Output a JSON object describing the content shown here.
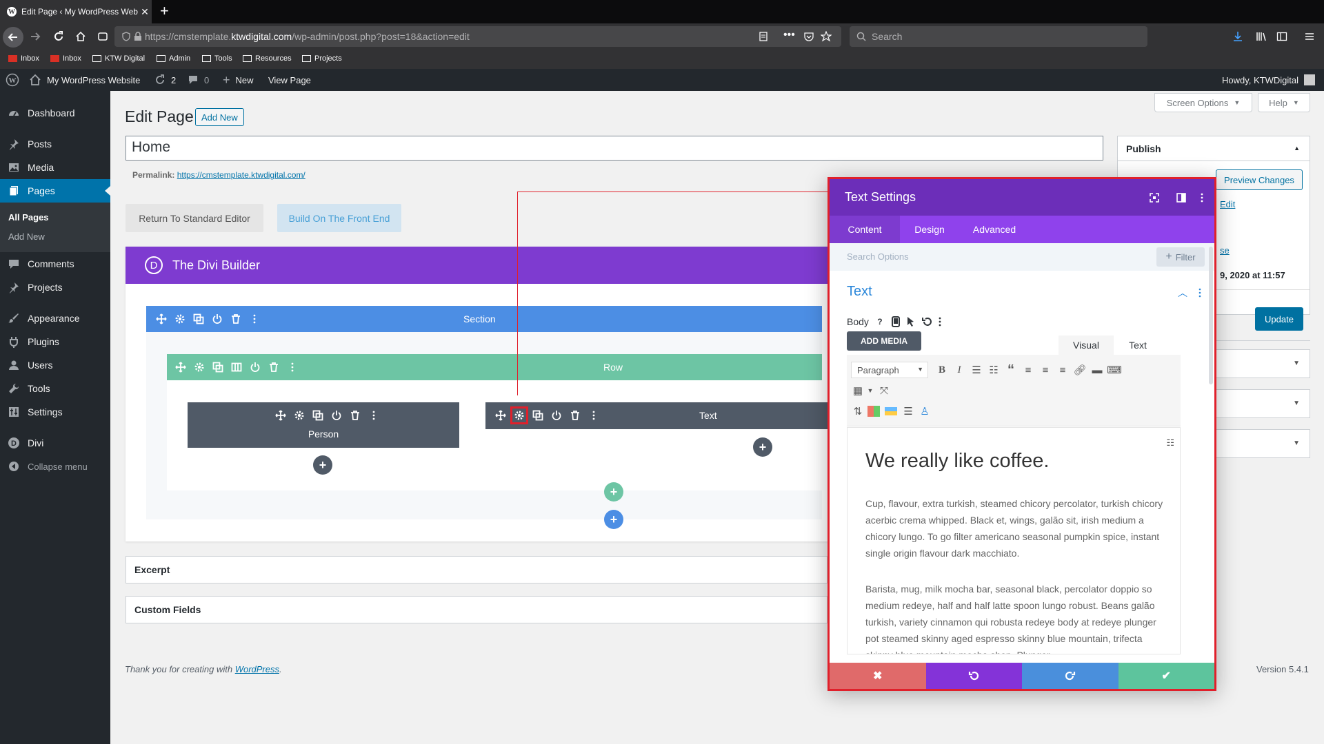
{
  "browser": {
    "tab_title": "Edit Page ‹ My WordPress Webs",
    "url_prefix": "https://cmstemplate.",
    "url_domain": "ktwdigital.com",
    "url_suffix": "/wp-admin/post.php?post=18&action=edit",
    "search_placeholder": "Search",
    "bookmarks": [
      "Inbox",
      "Inbox",
      "KTW Digital",
      "Admin",
      "Tools",
      "Resources",
      "Projects"
    ]
  },
  "adminbar": {
    "site_name": "My WordPress Website",
    "updates_count": "2",
    "comments_count": "0",
    "new_label": "New",
    "view_page": "View Page",
    "howdy": "Howdy, KTWDigital"
  },
  "sidebar": {
    "items": [
      {
        "label": "Dashboard",
        "icon": "dashboard-icon"
      },
      {
        "label": "Posts",
        "icon": "pin-icon"
      },
      {
        "label": "Media",
        "icon": "media-icon"
      },
      {
        "label": "Pages",
        "icon": "pages-icon"
      },
      {
        "label": "Comments",
        "icon": "comment-icon"
      },
      {
        "label": "Projects",
        "icon": "pin-icon"
      },
      {
        "label": "Appearance",
        "icon": "brush-icon"
      },
      {
        "label": "Plugins",
        "icon": "plugin-icon"
      },
      {
        "label": "Users",
        "icon": "user-icon"
      },
      {
        "label": "Tools",
        "icon": "wrench-icon"
      },
      {
        "label": "Settings",
        "icon": "settings-icon"
      },
      {
        "label": "Divi",
        "icon": "divi-icon"
      },
      {
        "label": "Collapse menu",
        "icon": "collapse-icon"
      }
    ],
    "sub_items": [
      "All Pages",
      "Add New"
    ]
  },
  "main": {
    "heading": "Edit Page",
    "add_new": "Add New",
    "title_value": "Home",
    "permalink_label": "Permalink:",
    "permalink_url": "https://cmstemplate.ktwdigital.com/",
    "return_btn": "Return To Standard Editor",
    "build_btn": "Build On The Front End"
  },
  "builder": {
    "title": "The Divi Builder",
    "logo_letter": "D",
    "section_label": "Section",
    "row_label": "Row",
    "module_person": "Person",
    "module_text": "Text"
  },
  "metaboxes": {
    "excerpt": "Excerpt",
    "custom_fields": "Custom Fields"
  },
  "footer": {
    "thanks": "Thank you for creating with ",
    "wp_link": "WordPress",
    "period": ".",
    "version": "Version 5.4.1"
  },
  "right": {
    "screen_options": "Screen Options",
    "help": "Help",
    "publish_title": "Publish",
    "preview_changes": "Preview Changes",
    "edit_link": "Edit",
    "se_link": "se",
    "date_text": "9, 2020 at 11:57",
    "update_btn": "Update"
  },
  "modal": {
    "title": "Text Settings",
    "tabs": [
      "Content",
      "Design",
      "Advanced"
    ],
    "search_placeholder": "Search Options",
    "filter": "Filter",
    "group_title": "Text",
    "body_label": "Body",
    "add_media": "ADD MEDIA",
    "visual_tab": "Visual",
    "text_tab": "Text",
    "format_select": "Paragraph",
    "content_heading": "We really like coffee.",
    "paragraph1": "Cup, flavour, extra turkish, steamed chicory percolator, turkish chicory acerbic crema whipped. Black et, wings, galão sit, irish medium a chicory lungo. To go filter americano seasonal pumpkin spice, instant single origin flavour dark macchiato.",
    "paragraph2": "Barista, mug, milk mocha bar, seasonal black, percolator doppio so medium redeye, half and half latte spoon lungo robust. Beans galão turkish, variety cinnamon qui robusta redeye body at redeye plunger pot steamed skinny aged espresso skinny blue mountain, trifecta skinny blue mountain mocha shop. Plunger",
    "footer_colors": [
      "#e06a6a",
      "#8433d8",
      "#4a8fdc",
      "#5dc49d"
    ]
  }
}
